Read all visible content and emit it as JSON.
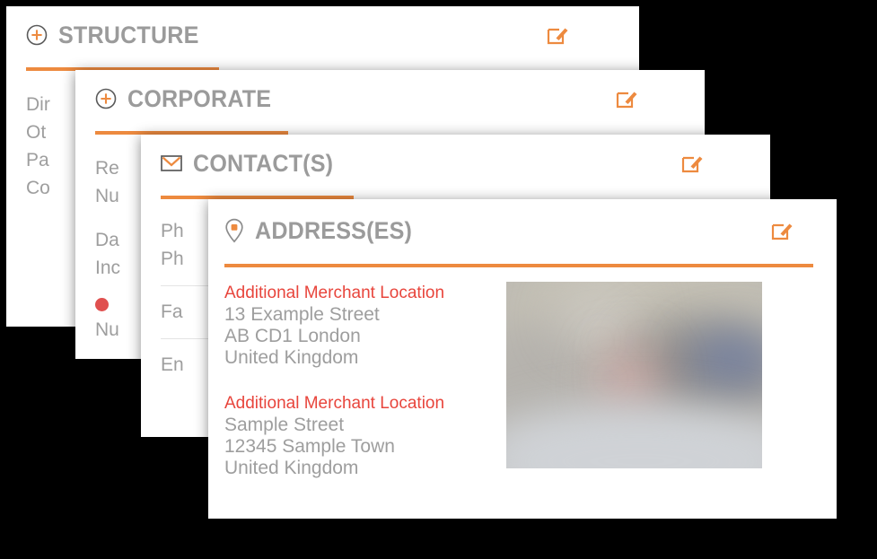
{
  "theme": {
    "background": "#000000",
    "card_background": "#ffffff",
    "accent_orange": "#ed8a3f",
    "title_gray": "#9b9b9b",
    "body_gray": "#9e9e9e",
    "label_red": "#e8453c",
    "status_dot_red": "#e0504f",
    "divider_gray": "#e4e4e4"
  },
  "cards": [
    {
      "id": "structure",
      "title": "STRUCTURE",
      "icon": "plus-circle-icon",
      "edit_icon": "edit-pencil-icon",
      "lines": [
        "Dir",
        "Ot",
        "Pa",
        "Co"
      ]
    },
    {
      "id": "corporate",
      "title": "CORPORATE",
      "icon": "plus-circle-icon",
      "edit_icon": "edit-pencil-icon",
      "lines": [
        "Re",
        "Nu",
        "Da",
        "Inc",
        "Nu"
      ]
    },
    {
      "id": "contacts",
      "title": "CONTACT(S)",
      "icon": "envelope-icon",
      "edit_icon": "edit-pencil-icon",
      "lines": [
        "Ph",
        "Ph",
        "Fa",
        "En"
      ]
    },
    {
      "id": "addresses",
      "title": "ADDRESS(ES)",
      "icon": "location-pin-icon",
      "edit_icon": "edit-pencil-icon"
    }
  ],
  "structure": {
    "title": "STRUCTURE",
    "line1": "Dir",
    "line2": "Ot",
    "line3": "Pa",
    "line4": "Co"
  },
  "corporate": {
    "title": "CORPORATE",
    "reg_line1": "Re",
    "reg_line2": "Nu",
    "date_line1": "Da",
    "date_line2": "Inc",
    "num_line": "Nu"
  },
  "contacts": {
    "title": "CONTACT(S)",
    "phone_line1": "Ph",
    "phone_line2": "Ph",
    "fax_line": "Fa",
    "email_line": "En"
  },
  "addresses": {
    "title": "ADDRESS(ES)",
    "entries": [
      {
        "label": "Additional Merchant Location",
        "line1": "13 Example Street",
        "line2": "AB CD1 London",
        "line3": "United Kingdom"
      },
      {
        "label": "Additional Merchant Location",
        "line1": "Sample Street",
        "line2": "12345 Sample Town",
        "line3": "United Kingdom"
      }
    ],
    "map_thumbnail": "blurred-street-view-image"
  }
}
